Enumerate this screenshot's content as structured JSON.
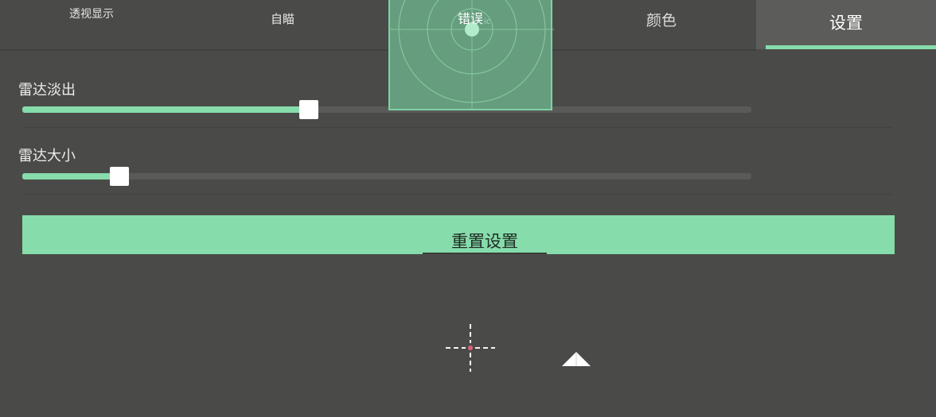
{
  "tabs": {
    "esp": "透视显示",
    "aim": "自瞄",
    "error": "错误",
    "color": "颜色",
    "settings": "设置"
  },
  "active_tab": "settings",
  "radar_preview": {
    "label": "ic"
  },
  "sliders": [
    {
      "label": "雷达淡出",
      "fraction": 0.393
    },
    {
      "label": "雷达大小",
      "fraction": 0.133
    }
  ],
  "reset_button": {
    "label": "重置设置"
  },
  "colors": {
    "background": "#4a4b48",
    "accent": "#86dcab",
    "tab_active_bg": "#5c5d5a",
    "radar_fill": "#669d7e",
    "track": "#5a5b58",
    "crosshair_center": "#e0607a"
  },
  "icons": {
    "crosshair": "crosshair-icon",
    "player_marker": "player-arrow-icon",
    "radar_center": "radar-center-dot-icon"
  }
}
